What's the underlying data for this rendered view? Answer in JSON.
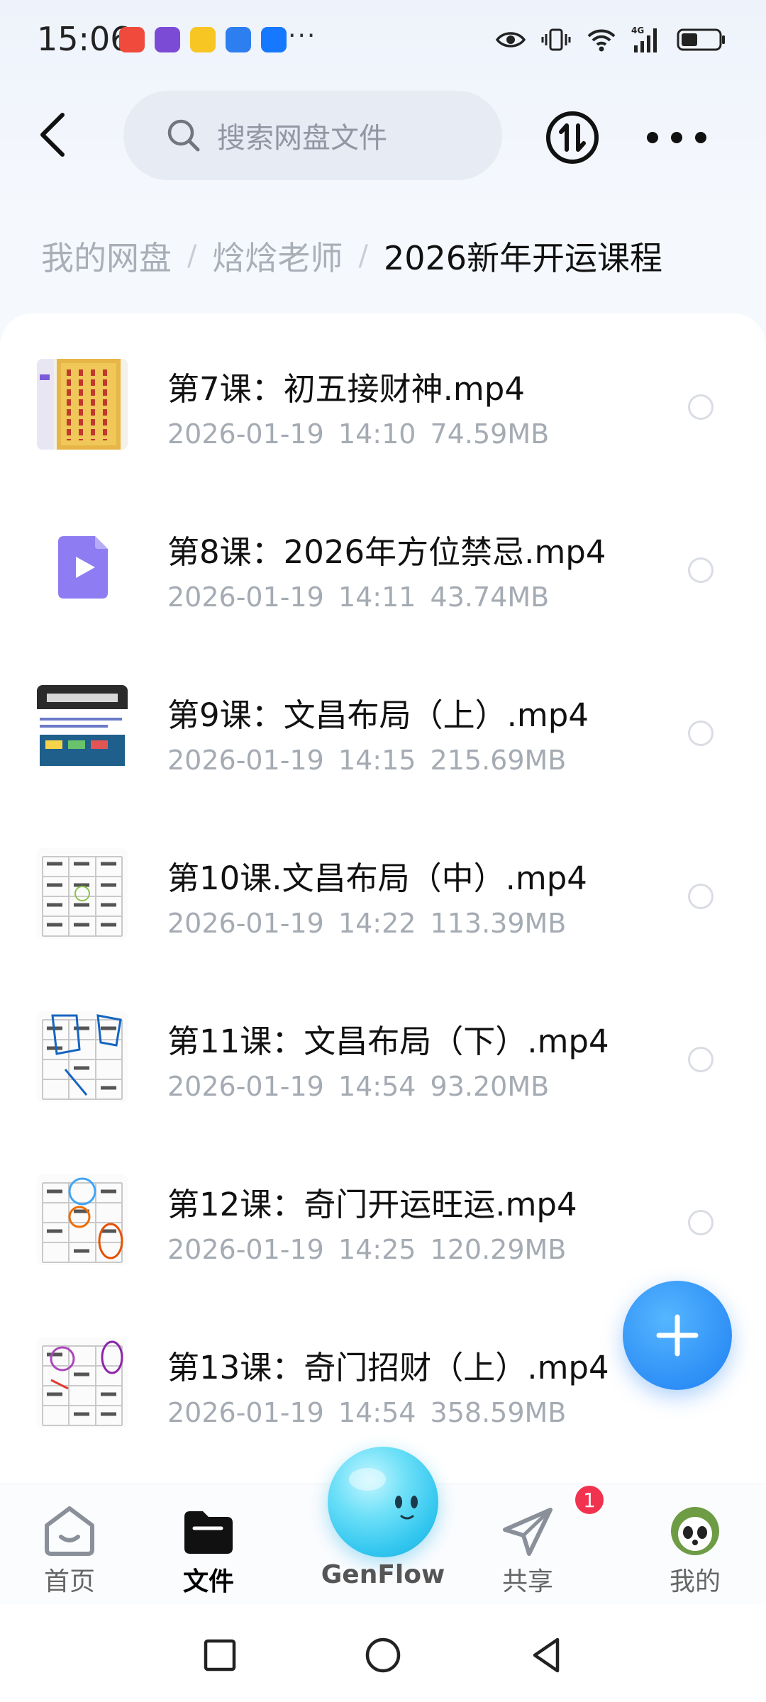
{
  "status_bar": {
    "time": "15:06",
    "more_indicator": "···",
    "network": "4G"
  },
  "header": {
    "search_placeholder": "搜索网盘文件"
  },
  "breadcrumb": {
    "items": [
      "我的网盘",
      "焓焓老师"
    ],
    "current": "2026新年开运课程",
    "separator": "/"
  },
  "files": [
    {
      "name": "第7课：初五接财神.mp4",
      "date": "2026-01-19",
      "time": "14:10",
      "size": "74.59MB",
      "thumb": "red-talisman"
    },
    {
      "name": "第8课：2026年方位禁忌.mp4",
      "date": "2026-01-19",
      "time": "14:11",
      "size": "43.74MB",
      "thumb": "video-icon"
    },
    {
      "name": "第9课：文昌布局（上）.mp4",
      "date": "2026-01-19",
      "time": "14:15",
      "size": "215.69MB",
      "thumb": "slide"
    },
    {
      "name": "第10课.文昌布局（中）.mp4",
      "date": "2026-01-19",
      "time": "14:22",
      "size": "113.39MB",
      "thumb": "chart"
    },
    {
      "name": "第11课：文昌布局（下）.mp4",
      "date": "2026-01-19",
      "time": "14:54",
      "size": "93.20MB",
      "thumb": "chart-blue"
    },
    {
      "name": "第12课：奇门开运旺运.mp4",
      "date": "2026-01-19",
      "time": "14:25",
      "size": "120.29MB",
      "thumb": "chart-orange"
    },
    {
      "name": "第13课：奇门招财（上）.mp4",
      "date": "2026-01-19",
      "time": "14:54",
      "size": "358.59MB",
      "thumb": "chart-purple"
    }
  ],
  "bottom_nav": {
    "home": "首页",
    "files": "文件",
    "genflow": "GenFlow",
    "share": "共享",
    "share_badge": "1",
    "mine": "我的"
  },
  "colors": {
    "accent": "#1e7ff2",
    "badge": "#f2334f",
    "text_secondary": "#a5abb3"
  }
}
